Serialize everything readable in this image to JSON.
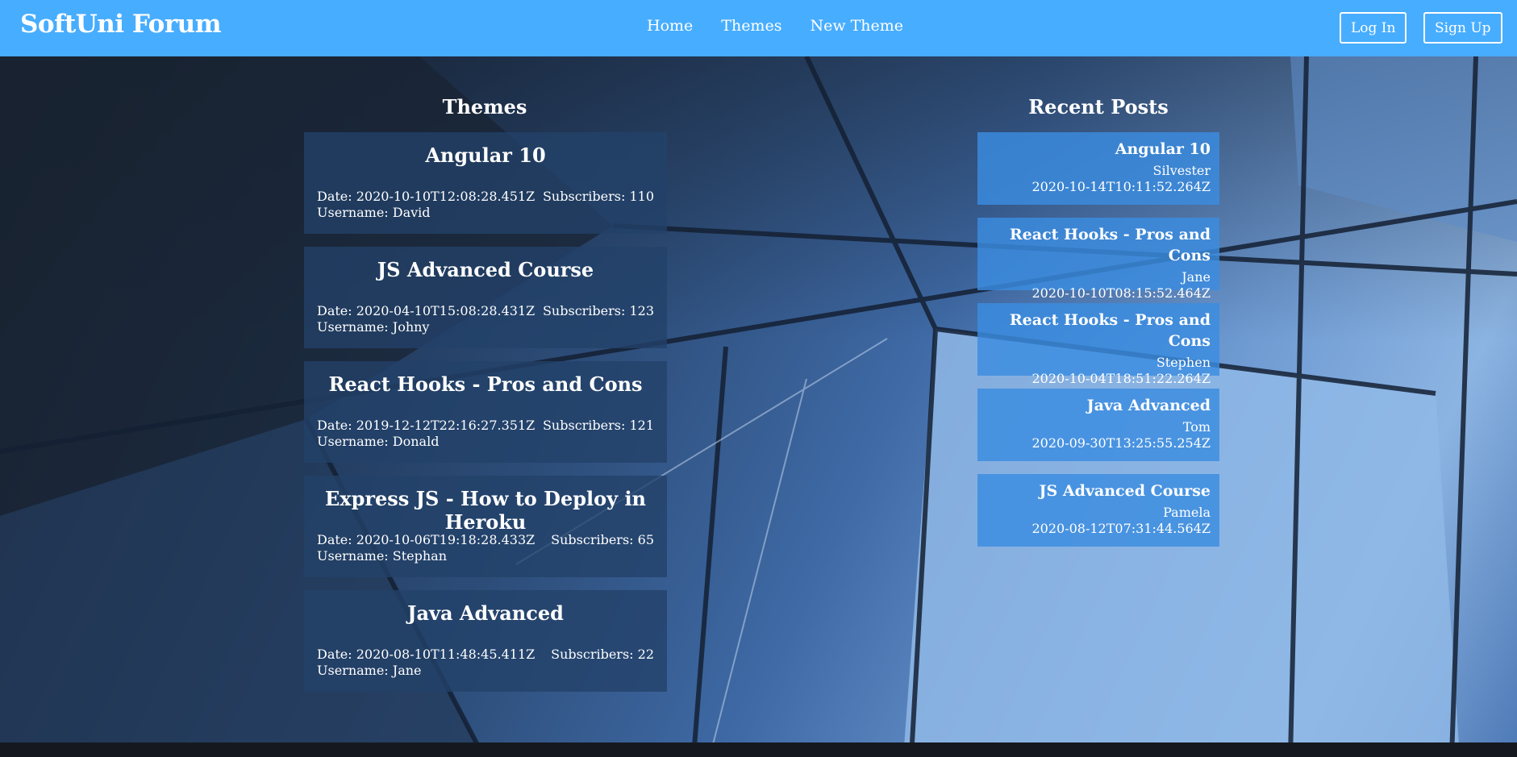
{
  "header": {
    "logo": "SoftUni Forum",
    "nav": [
      "Home",
      "Themes",
      "New Theme"
    ],
    "login_label": "Log In",
    "signup_label": "Sign Up",
    "color": "#47adff"
  },
  "themes_section": {
    "title": "Themes",
    "items": [
      {
        "title": "Angular 10",
        "date": "Date: 2020-10-10T12:08:28.451Z",
        "subscribers": "Subscribers: 110",
        "username": "Username: David"
      },
      {
        "title": "JS Advanced Course",
        "date": "Date: 2020-04-10T15:08:28.431Z",
        "subscribers": "Subscribers: 123",
        "username": "Username: Johny"
      },
      {
        "title": "React Hooks - Pros and Cons",
        "date": "Date: 2019-12-12T22:16:27.351Z",
        "subscribers": "Subscribers: 121",
        "username": "Username: Donald"
      },
      {
        "title": "Express JS - How to Deploy in Heroku",
        "date": "Date: 2020-10-06T19:18:28.433Z",
        "subscribers": "Subscribers: 65",
        "username": "Username: Stephan"
      },
      {
        "title": "Java Advanced",
        "date": "Date: 2020-08-10T11:48:45.411Z",
        "subscribers": "Subscribers: 22",
        "username": "Username: Jane"
      }
    ]
  },
  "posts_section": {
    "title": "Recent Posts",
    "items": [
      {
        "title": "Angular 10",
        "user": "Silvester",
        "date": "2020-10-14T10:11:52.264Z"
      },
      {
        "title": "React Hooks - Pros and Cons",
        "user": "Jane",
        "date": "2020-10-10T08:15:52.464Z"
      },
      {
        "title": "React Hooks - Pros and Cons",
        "user": "Stephen",
        "date": "2020-10-04T18:51:22.264Z"
      },
      {
        "title": "Java Advanced",
        "user": "Tom",
        "date": "2020-09-30T13:25:55.254Z"
      },
      {
        "title": "JS Advanced Course",
        "user": "Pamela",
        "date": "2020-08-12T07:31:44.564Z"
      }
    ]
  }
}
